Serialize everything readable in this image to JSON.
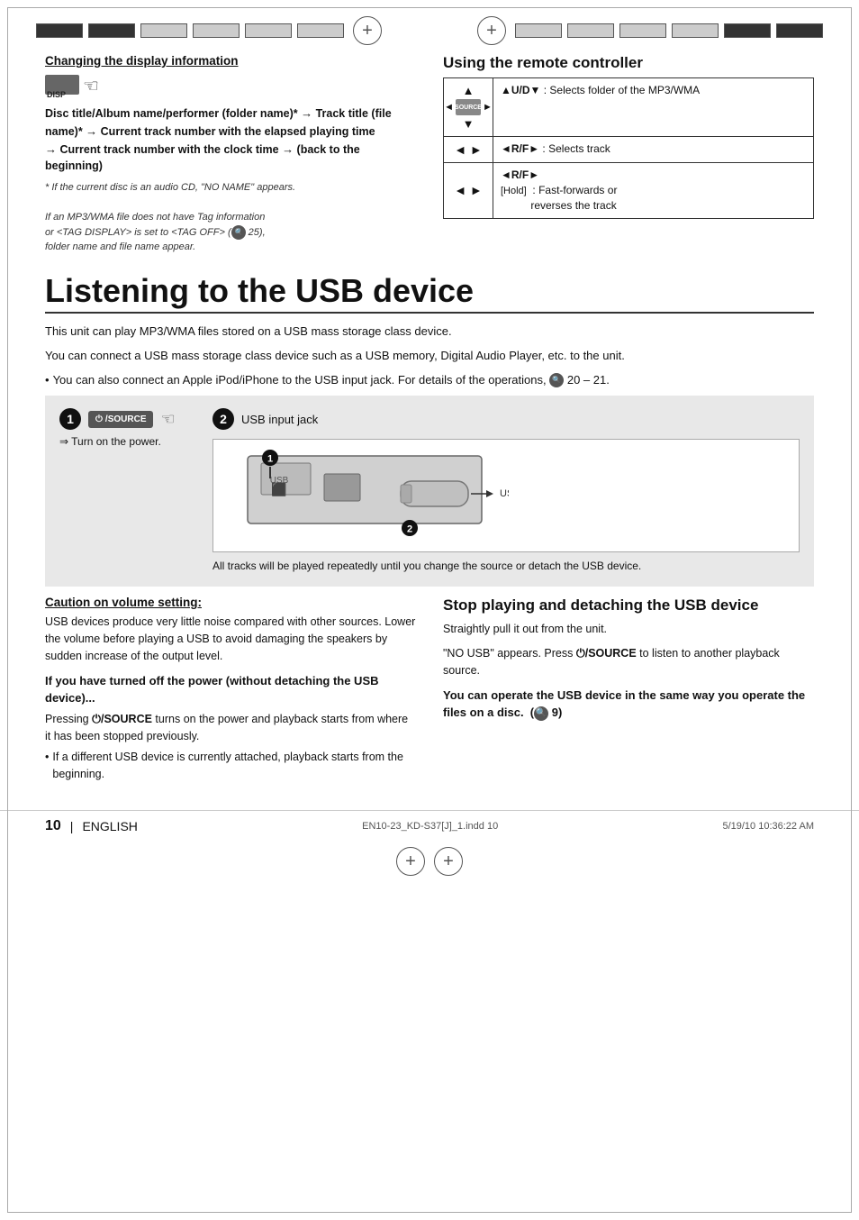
{
  "page": {
    "top_left_section": {
      "title": "Changing the display information",
      "display_flow": "Disc title/Album name/performer (folder name)* → Track title (file name)* → Current track number with the elapsed playing time → Current track number with the clock time → (back to the beginning)",
      "note1": "* If the current disc is an audio CD, \"NO NAME\" appears.",
      "note2": "If an MP3/WMA file does not have Tag information or <TAG DISPLAY> is set to <TAG OFF> (",
      "note2b": "25), folder name and file name appear.",
      "disp_label": "DISP"
    },
    "remote_section": {
      "title": "Using the remote controller",
      "rows": [
        {
          "icon_type": "ud",
          "desc": "▲U/D▼ : Selects folder of the MP3/WMA"
        },
        {
          "icon_type": "lr",
          "desc": "◄R/F► : Selects track"
        },
        {
          "icon_type": "lr_hold",
          "desc_prefix": "◄R/F►",
          "desc_label": "[Hold]",
          "desc_text": ": Fast-forwards or reverses the track"
        }
      ]
    },
    "big_section": {
      "title": "Listening to the USB device",
      "intro1": "This unit can play MP3/WMA files stored on a USB mass storage class device.",
      "intro2": "You can connect a USB mass storage class device such as a USB memory, Digital Audio Player, etc. to the unit.",
      "bullet": "• You can also connect an Apple iPod/iPhone to the USB input jack. For details of the operations,",
      "bullet_ref": "20 – 21.",
      "step1": {
        "number": "1",
        "button_label": "⏻/SOURCE",
        "desc": "⇒ Turn on the power."
      },
      "step2": {
        "number": "2",
        "label_top": "USB input jack",
        "label_bot": "USB memory",
        "note": "All tracks will be played repeatedly until you change the source or detach the USB device."
      }
    },
    "bottom_left": {
      "caution_title": "Caution on volume setting:",
      "caution_text": "USB devices produce very little noise compared with other sources. Lower the volume before playing a USB to avoid damaging the speakers by sudden increase of the output level.",
      "sub_heading": "If you have turned off the power (without detaching the USB device)...",
      "body1": "Pressing ⏻/SOURCE turns on the power and playback starts from where it has been stopped previously.",
      "bullet": "• If a different USB device is currently attached, playback starts from the beginning."
    },
    "bottom_right": {
      "stop_title": "Stop playing and detaching the USB device",
      "stop_text1": "Straightly pull it out from the unit.",
      "stop_text2": "\"NO USB\" appears. Press ⏻/SOURCE to listen to another playback source.",
      "bold_note": "You can operate the USB device in the same way you operate the files on a disc.  (  9)"
    },
    "footer": {
      "page_num": "10",
      "lang": "ENGLISH",
      "file_ref": "EN10-23_KD-S37[J]_1.indd   10",
      "date": "5/19/10   10:36:22 AM"
    }
  }
}
